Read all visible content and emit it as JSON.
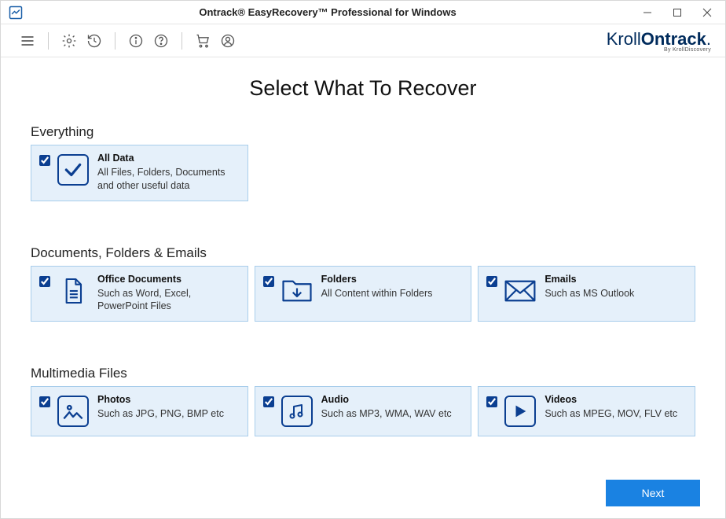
{
  "title": "Ontrack® EasyRecovery™ Professional for Windows",
  "brand": {
    "kroll": "Kroll",
    "ontrack": "Ontrack",
    "sub": "By KrollDiscovery",
    "dot": "."
  },
  "page_title": "Select What To Recover",
  "sections": {
    "everything": {
      "label": "Everything",
      "card": {
        "title": "All Data",
        "desc": "All Files, Folders, Documents and other useful data"
      }
    },
    "docs": {
      "label": "Documents, Folders & Emails",
      "cards": [
        {
          "title": "Office Documents",
          "desc": "Such as Word, Excel, PowerPoint Files"
        },
        {
          "title": "Folders",
          "desc": "All Content within Folders"
        },
        {
          "title": "Emails",
          "desc": "Such as MS Outlook"
        }
      ]
    },
    "media": {
      "label": "Multimedia Files",
      "cards": [
        {
          "title": "Photos",
          "desc": "Such as JPG, PNG, BMP etc"
        },
        {
          "title": "Audio",
          "desc": "Such as MP3, WMA, WAV etc"
        },
        {
          "title": "Videos",
          "desc": "Such as MPEG, MOV, FLV etc"
        }
      ]
    }
  },
  "footer": {
    "next": "Next"
  }
}
